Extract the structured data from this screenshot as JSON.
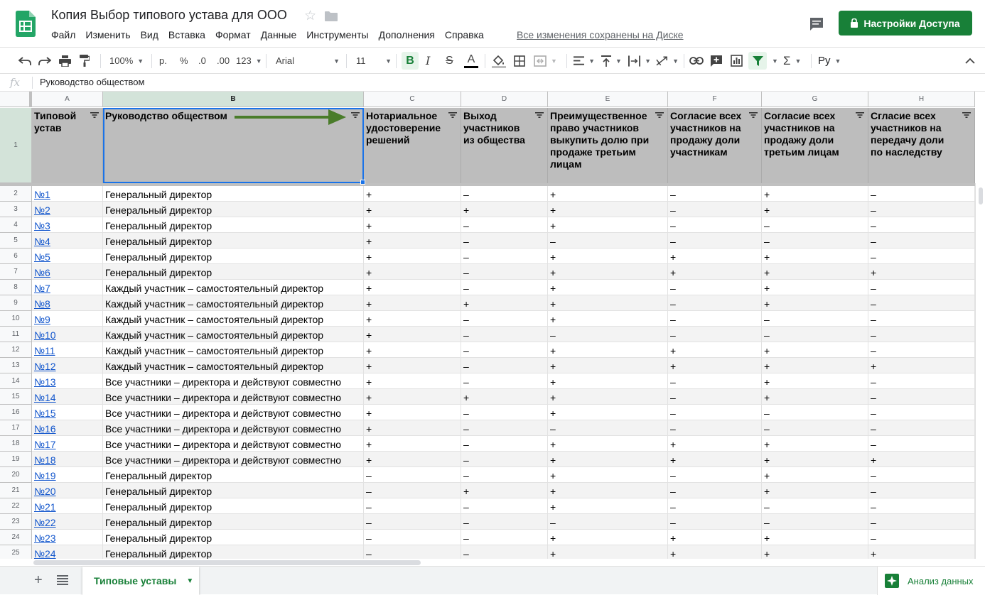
{
  "doc": {
    "title": "Копия Выбор типового устава для ООО",
    "save_status": "Все изменения сохранены на Диске",
    "share_label": "Настройки Доступа"
  },
  "menu": [
    "Файл",
    "Изменить",
    "Вид",
    "Вставка",
    "Формат",
    "Данные",
    "Инструменты",
    "Дополнения",
    "Справка"
  ],
  "toolbar": {
    "zoom": "100%",
    "currency": "р.",
    "percent": "%",
    "dec_less": ".0",
    "dec_more": ".00",
    "number_format": "123",
    "font": "Arial",
    "font_size": "11",
    "bold": "B",
    "italic": "I",
    "strike": "S",
    "text_color": "A",
    "input_tools": "Ру"
  },
  "formula_bar": {
    "fx": "fx",
    "value": "Руководство обществом"
  },
  "columns": [
    "A",
    "B",
    "C",
    "D",
    "E",
    "F",
    "G",
    "H"
  ],
  "header_row": {
    "number": "1",
    "cells": [
      "Типовой устав",
      "Руководство обществом",
      "Нотариальное удостоверение решений",
      "Выход участников из общества",
      "Преимущественное право участников выкупить долю при продаже третьим лицам",
      "Согласие всех участников на продажу доли участникам",
      "Согласие всех участников на продажу доли третьим лицам",
      "Сгласие всех участников на передачу доли по наследству"
    ]
  },
  "rows": [
    {
      "n": "2",
      "c": [
        "№1",
        "Генеральный директор",
        "+",
        "–",
        "+",
        "–",
        "+",
        "–"
      ]
    },
    {
      "n": "3",
      "c": [
        "№2",
        "Генеральный директор",
        "+",
        "+",
        "+",
        "–",
        "+",
        "–"
      ]
    },
    {
      "n": "4",
      "c": [
        "№3",
        "Генеральный директор",
        "+",
        "–",
        "+",
        "–",
        "–",
        "–"
      ]
    },
    {
      "n": "5",
      "c": [
        "№4",
        "Генеральный директор",
        "+",
        "–",
        "–",
        "–",
        "–",
        "–"
      ]
    },
    {
      "n": "6",
      "c": [
        "№5",
        "Генеральный директор",
        "+",
        "–",
        "+",
        "+",
        "+",
        "–"
      ]
    },
    {
      "n": "7",
      "c": [
        "№6",
        "Генеральный директор",
        "+",
        "–",
        "+",
        "+",
        "+",
        "+"
      ]
    },
    {
      "n": "8",
      "c": [
        "№7",
        "Каждый участник – самостоятельный директор",
        "+",
        "–",
        "+",
        "–",
        "+",
        "–"
      ]
    },
    {
      "n": "9",
      "c": [
        "№8",
        "Каждый участник – самостоятельный директор",
        "+",
        "+",
        "+",
        "–",
        "+",
        "–"
      ]
    },
    {
      "n": "10",
      "c": [
        "№9",
        "Каждый участник – самостоятельный директор",
        "+",
        "–",
        "+",
        "–",
        "–",
        "–"
      ]
    },
    {
      "n": "11",
      "c": [
        "№10",
        "Каждый участник – самостоятельный директор",
        "+",
        "–",
        "–",
        "–",
        "–",
        "–"
      ]
    },
    {
      "n": "12",
      "c": [
        "№11",
        "Каждый участник – самостоятельный директор",
        "+",
        "–",
        "+",
        "+",
        "+",
        "–"
      ]
    },
    {
      "n": "13",
      "c": [
        "№12",
        "Каждый участник – самостоятельный директор",
        "+",
        "–",
        "+",
        "+",
        "+",
        "+"
      ]
    },
    {
      "n": "14",
      "c": [
        "№13",
        "Все участники – директора и действуют совместно",
        "+",
        "–",
        "+",
        "–",
        "+",
        "–"
      ]
    },
    {
      "n": "15",
      "c": [
        "№14",
        "Все участники – директора и действуют совместно",
        "+",
        "+",
        "+",
        "–",
        "+",
        "–"
      ]
    },
    {
      "n": "16",
      "c": [
        "№15",
        "Все участники – директора и действуют совместно",
        "+",
        "–",
        "+",
        "–",
        "–",
        "–"
      ]
    },
    {
      "n": "17",
      "c": [
        "№16",
        "Все участники – директора и действуют совместно",
        "+",
        "–",
        "–",
        "–",
        "–",
        "–"
      ]
    },
    {
      "n": "18",
      "c": [
        "№17",
        "Все участники – директора и действуют совместно",
        "+",
        "–",
        "+",
        "+",
        "+",
        "–"
      ]
    },
    {
      "n": "19",
      "c": [
        "№18",
        "Все участники – директора и действуют совместно",
        "+",
        "–",
        "+",
        "+",
        "+",
        "+"
      ]
    },
    {
      "n": "20",
      "c": [
        "№19",
        "Генеральный директор",
        "–",
        "–",
        "+",
        "–",
        "+",
        "–"
      ]
    },
    {
      "n": "21",
      "c": [
        "№20",
        "Генеральный директор",
        "–",
        "+",
        "+",
        "–",
        "+",
        "–"
      ]
    },
    {
      "n": "22",
      "c": [
        "№21",
        "Генеральный директор",
        "–",
        "–",
        "+",
        "–",
        "–",
        "–"
      ]
    },
    {
      "n": "23",
      "c": [
        "№22",
        "Генеральный директор",
        "–",
        "–",
        "–",
        "–",
        "–",
        "–"
      ]
    },
    {
      "n": "24",
      "c": [
        "№23",
        "Генеральный директор",
        "–",
        "–",
        "+",
        "+",
        "+",
        "–"
      ]
    },
    {
      "n": "25",
      "c": [
        "№24",
        "Генеральный директор",
        "–",
        "–",
        "+",
        "+",
        "+",
        "+"
      ]
    }
  ],
  "sheet_tab": "Типовые уставы",
  "explore_label": "Анализ данных",
  "colors": {
    "accent": "#188038",
    "link": "#1155cc",
    "selection": "#1a73e8",
    "header_fill": "#bdbdbd",
    "arrow": "#4a7c2a"
  }
}
